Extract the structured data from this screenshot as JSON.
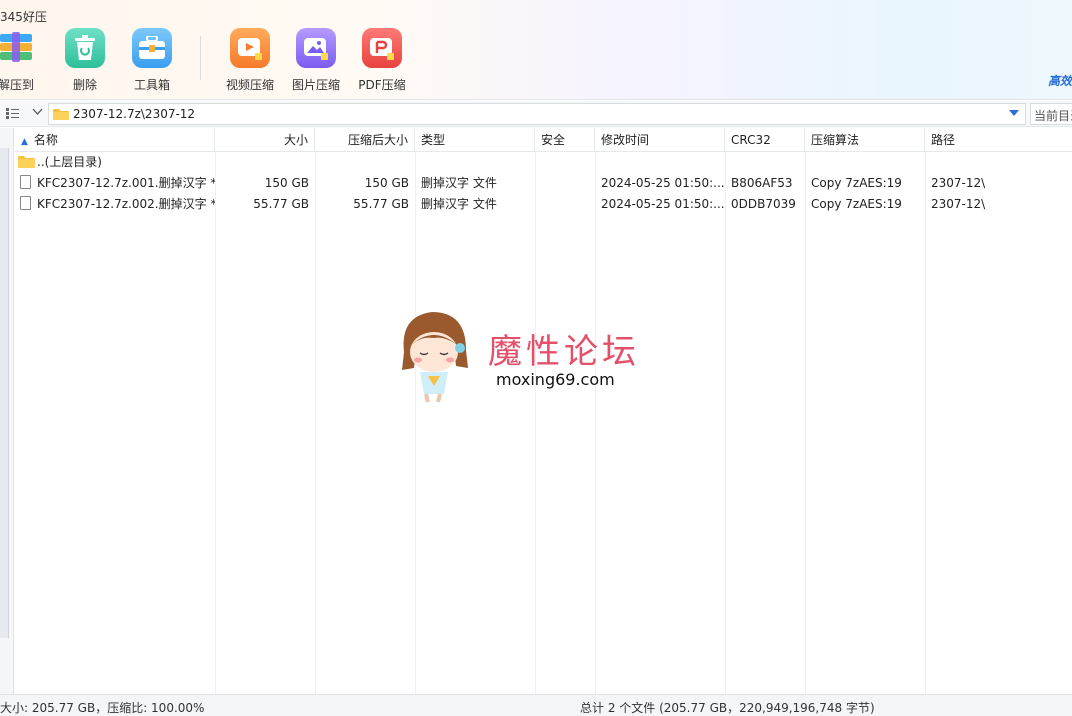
{
  "app": {
    "title": "345好压",
    "brand_tag": "高效"
  },
  "toolbar": {
    "items": [
      {
        "label": "解压到",
        "icon": "extract-icon"
      },
      {
        "label": "删除",
        "icon": "trash-icon"
      },
      {
        "label": "工具箱",
        "icon": "toolbox-icon"
      },
      {
        "label": "视频压缩",
        "icon": "video-compress-icon"
      },
      {
        "label": "图片压缩",
        "icon": "image-compress-icon"
      },
      {
        "label": "PDF压缩",
        "icon": "pdf-compress-icon"
      }
    ]
  },
  "address": {
    "path": "2307-12.7z\\2307-12",
    "search_placeholder": "当前目录"
  },
  "table": {
    "columns": [
      "名称",
      "大小",
      "压缩后大小",
      "类型",
      "安全",
      "修改时间",
      "CRC32",
      "压缩算法",
      "路径"
    ],
    "parent_row": "..(上层目录)",
    "rows": [
      {
        "name": "KFC2307-12.7z.001.删掉汉字 *",
        "size": "150 GB",
        "packed": "150 GB",
        "type": "删掉汉字 文件",
        "safe": "",
        "mtime": "2024-05-25 01:50:...",
        "crc": "B806AF53",
        "method": "Copy 7zAES:19",
        "path": "2307-12\\"
      },
      {
        "name": "KFC2307-12.7z.002.删掉汉字 *",
        "size": "55.77 GB",
        "packed": "55.77 GB",
        "type": "删掉汉字 文件",
        "safe": "",
        "mtime": "2024-05-25 01:50:...",
        "crc": "0DDB7039",
        "method": "Copy 7zAES:19",
        "path": "2307-12\\"
      }
    ]
  },
  "watermark": {
    "title": "魔性论坛",
    "url": "moxing69.com"
  },
  "status": {
    "left": "大小: 205.77 GB，压缩比: 100.00%",
    "right": "总计 2 个文件 (205.77 GB，220,949,196,748 字节)"
  },
  "colors": {
    "accent": "#2a6fd6",
    "watermark": "#e4506a"
  }
}
